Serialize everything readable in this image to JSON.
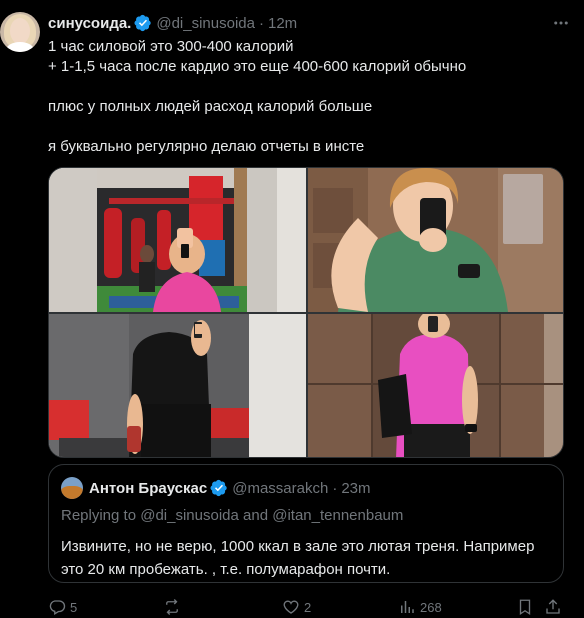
{
  "tweet": {
    "author_name": "синусоида.",
    "handle": "@di_sinusoida",
    "separator": "·",
    "time": "12m",
    "text_lines": [
      "1 час силовой это 300-400 калорий",
      "+ 1-1,5 часа после кардио это еще 400-600 калорий обычно",
      "плюс у полных людей расход калорий больше",
      "я буквально регулярно делаю отчеты в инсте"
    ]
  },
  "quoted": {
    "author_name": "Антон Браускас",
    "handle": "@massarakch",
    "separator": "·",
    "time": "23m",
    "reply_prefix": "Replying to ",
    "reply_mention_1": "@di_sinusoida",
    "reply_and": " and ",
    "reply_mention_2": "@itan_tennenbaum",
    "text": "Извините, но не верю, 1000 ккал в зале это лютая треня. Например это 20 км пробежать. , т.е. полумарафон почти."
  },
  "actions": {
    "replies": "5",
    "reposts": "",
    "likes": "2",
    "views": "268"
  },
  "colors": {
    "background": "#000000",
    "text": "#e7e9ea",
    "muted": "#71767b",
    "border": "#2f3336",
    "verified": "#1d9bf0"
  },
  "icons": [
    "more-icon",
    "verified-icon",
    "reply-icon",
    "repost-icon",
    "like-icon",
    "views-icon",
    "bookmark-icon",
    "share-icon"
  ]
}
